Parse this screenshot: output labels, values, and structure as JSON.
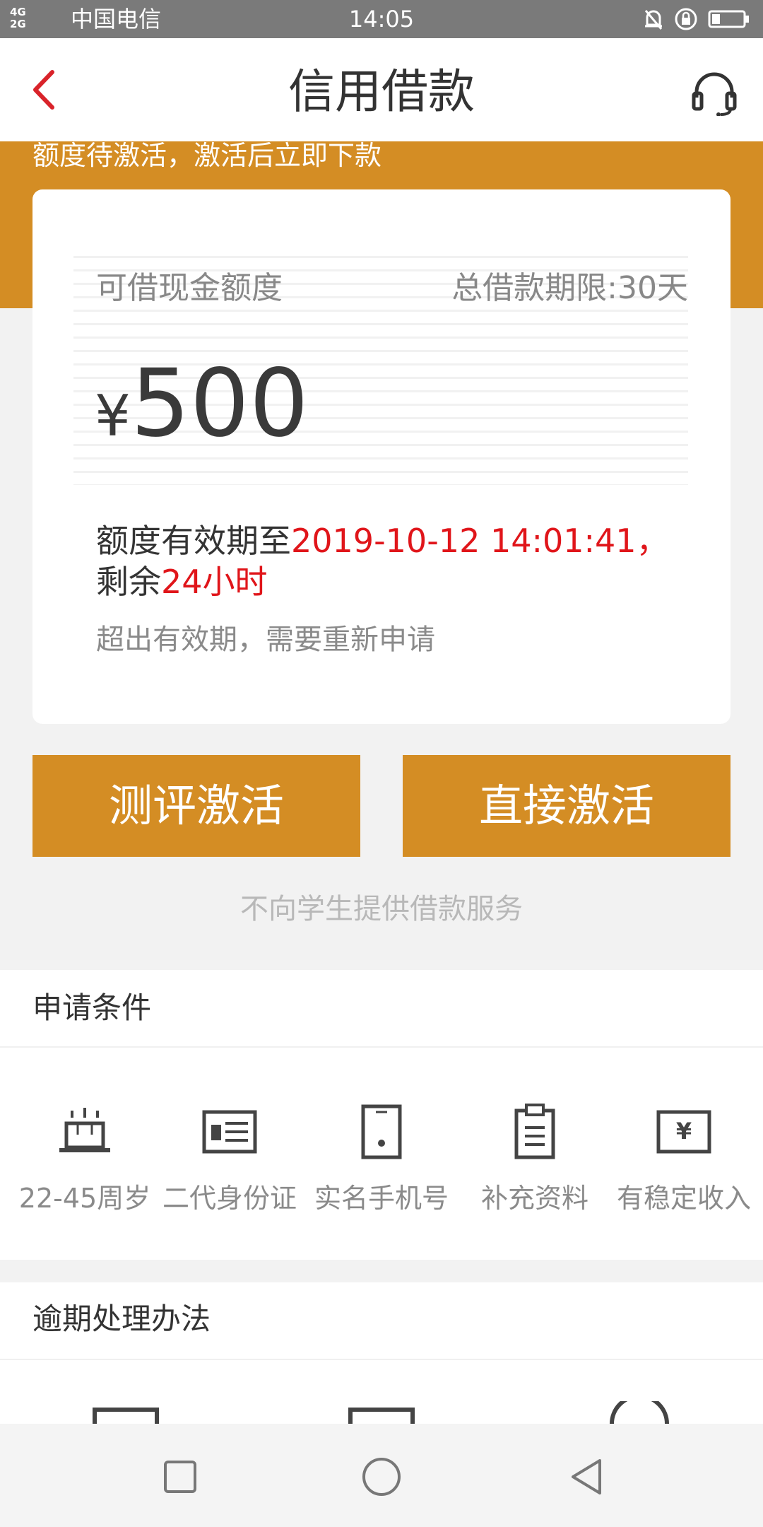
{
  "status_bar": {
    "net_top": "4G",
    "net_bottom": "2G",
    "carrier": "中国电信",
    "time": "14:05"
  },
  "header": {
    "title": "信用借款",
    "back_icon": "chevron-left-icon",
    "service_icon": "headset-icon"
  },
  "banner": {
    "notice": "额度待激活，激活后立即下款"
  },
  "card": {
    "limit_label": "可借现金额度",
    "term_label": "总借款期限:30天",
    "currency": "¥",
    "amount": "500",
    "validity_prefix": "额度有效期至",
    "validity_date": "2019-10-12 14:01:41，",
    "validity_mid": "剩余",
    "validity_remaining": "24小时",
    "expire_hint": "超出有效期，需要重新申请"
  },
  "actions": {
    "evaluate_activate": "测评激活",
    "direct_activate": "直接激活",
    "no_student_notice": "不向学生提供借款服务"
  },
  "conditions": {
    "title": "申请条件",
    "items": [
      {
        "icon": "birthday-cake-icon",
        "label": "22-45周岁"
      },
      {
        "icon": "id-card-icon",
        "label": "二代身份证"
      },
      {
        "icon": "mobile-phone-icon",
        "label": "实名手机号"
      },
      {
        "icon": "clipboard-icon",
        "label": "补充资料"
      },
      {
        "icon": "income-icon",
        "label": "有稳定收入"
      }
    ]
  },
  "overdue": {
    "title": "逾期处理办法"
  },
  "colors": {
    "brand_orange": "#d48d24",
    "highlight_red": "#e0151a",
    "back_red": "#d9232a"
  }
}
